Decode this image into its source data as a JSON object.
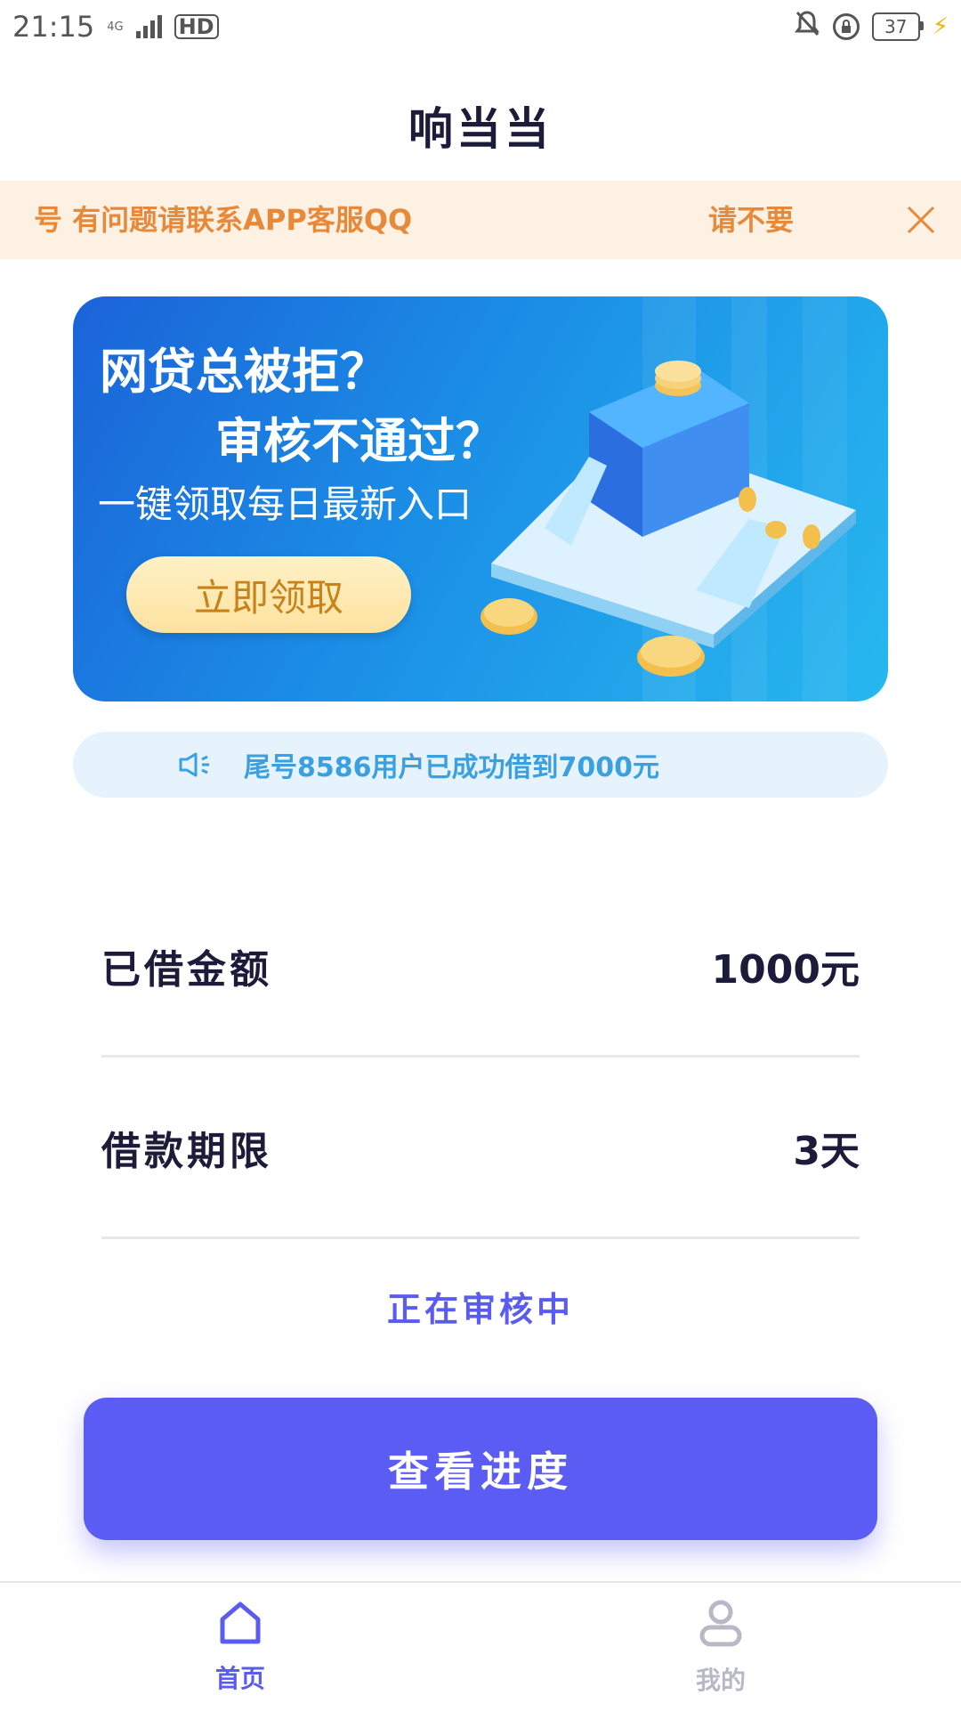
{
  "status_bar": {
    "time": "21:15",
    "network_tag": "4G",
    "hd_label": "HD",
    "battery_level": "37"
  },
  "nav": {
    "title": "响当当"
  },
  "notice": {
    "segment_a": "号  有问题请联系APP客服QQ",
    "segment_b": "请不要"
  },
  "banner": {
    "line1": "网贷总被拒？",
    "line2": "审核不通过？",
    "line3": "一键领取每日最新入口",
    "button_label": "立即领取"
  },
  "ticker": {
    "text": "尾号8586用户已成功借到7000元"
  },
  "details": {
    "amount_label": "已借金额",
    "amount_value": "1000元",
    "term_label": "借款期限",
    "term_value": "3天"
  },
  "status_text": "正在审核中",
  "primary_button": {
    "label": "查看进度"
  },
  "tabbar": {
    "home_label": "首页",
    "mine_label": "我的"
  },
  "colors": {
    "accent": "#5a5cf4",
    "notice_text": "#e8893a",
    "notice_bg": "#fdf1e4",
    "ticker_text": "#3aa0df",
    "ticker_bg": "#e6f3fd"
  },
  "icons": {
    "notification_muted": "bell-off-icon",
    "lock_rotation": "lock-icon",
    "charging": "bolt-icon",
    "close": "close-icon",
    "speaker": "speaker-icon",
    "home": "home-icon",
    "profile": "user-icon"
  }
}
